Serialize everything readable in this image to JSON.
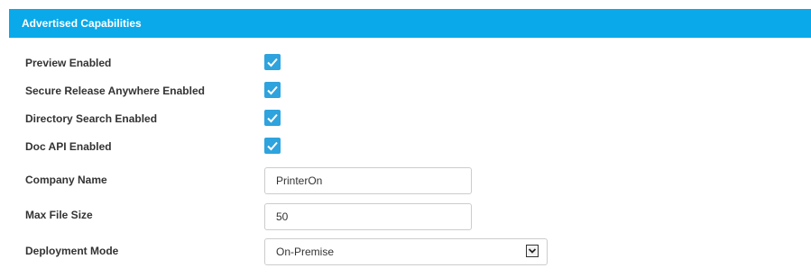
{
  "panel": {
    "title": "Advertised Capabilities"
  },
  "capabilities": [
    {
      "label": "Preview Enabled",
      "checked": true,
      "icon": "checkmark-icon"
    },
    {
      "label": "Secure Release Anywhere Enabled",
      "checked": true,
      "icon": "checkmark-icon"
    },
    {
      "label": "Directory Search Enabled",
      "checked": true,
      "icon": "checkmark-icon"
    },
    {
      "label": "Doc API Enabled",
      "checked": true,
      "icon": "checkmark-icon"
    }
  ],
  "company_name": {
    "label": "Company Name",
    "value": "PrinterOn"
  },
  "max_file_size": {
    "label": "Max File Size",
    "value": "50"
  },
  "deployment_mode": {
    "label": "Deployment Mode",
    "value": "On-Premise",
    "icon": "chevron-down-icon"
  },
  "colors": {
    "header_bg": "#0aa9e9",
    "checkbox_bg": "#2ea3dd",
    "label_text": "#333333"
  }
}
